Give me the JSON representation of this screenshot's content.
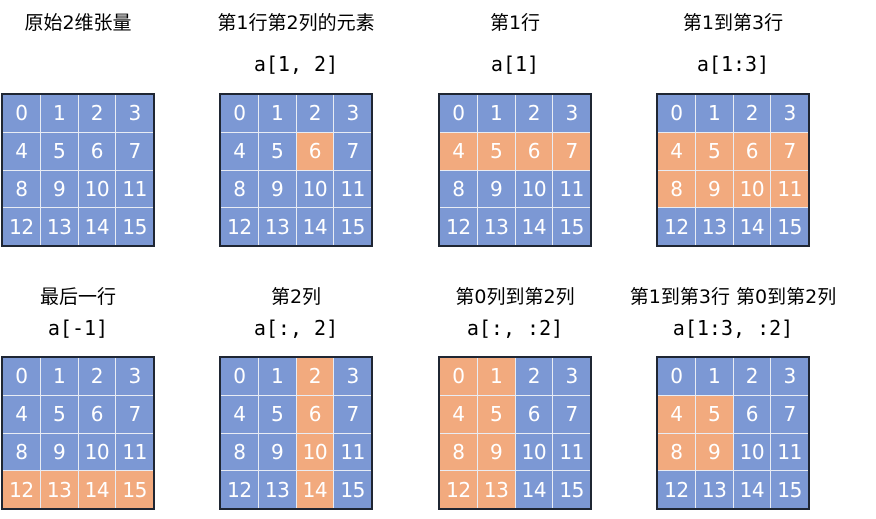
{
  "colors": {
    "cell_default": "#7c98d4",
    "cell_selected": "#f2aa7e",
    "border": "#1f2633"
  },
  "panels": [
    {
      "title": "原始2维张量",
      "code": "",
      "selected": []
    },
    {
      "title": "第1行第2列的元素",
      "code": "a[1, 2]",
      "selected": [
        6
      ]
    },
    {
      "title": "第1行",
      "code": "a[1]",
      "selected": [
        4,
        5,
        6,
        7
      ]
    },
    {
      "title": "第1到第3行",
      "code": "a[1:3]",
      "selected": [
        4,
        5,
        6,
        7,
        8,
        9,
        10,
        11
      ]
    },
    {
      "title": "最后一行",
      "code": "a[-1]",
      "selected": [
        12,
        13,
        14,
        15
      ]
    },
    {
      "title": "第2列",
      "code": "a[:, 2]",
      "selected": [
        2,
        6,
        10,
        14
      ]
    },
    {
      "title": "第0列到第2列",
      "code": "a[:, :2]",
      "selected": [
        0,
        1,
        4,
        5,
        8,
        9,
        12,
        13
      ]
    },
    {
      "title": "第1到第3行 第0到第2列",
      "code": "a[1:3, :2]",
      "selected": [
        4,
        5,
        8,
        9
      ]
    }
  ],
  "cells": [
    "0",
    "1",
    "2",
    "3",
    "4",
    "5",
    "6",
    "7",
    "8",
    "9",
    "10",
    "11",
    "12",
    "13",
    "14",
    "15"
  ]
}
